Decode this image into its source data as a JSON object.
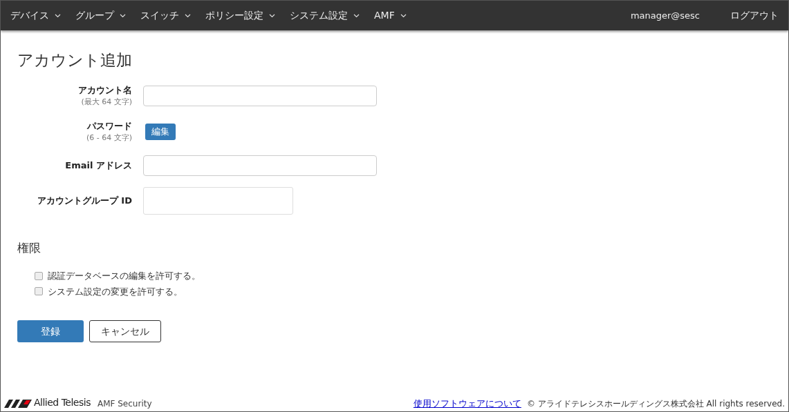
{
  "nav": {
    "menus": [
      {
        "label": "デバイス"
      },
      {
        "label": "グループ"
      },
      {
        "label": "スイッチ"
      },
      {
        "label": "ポリシー設定"
      },
      {
        "label": "システム設定"
      },
      {
        "label": "AMF"
      }
    ],
    "user": "manager@sesc",
    "logout": "ログアウト"
  },
  "page_title": "アカウント追加",
  "fields": [
    {
      "kind": "input",
      "label": "アカウント名",
      "hint": "(最大 64 文字)"
    },
    {
      "kind": "button",
      "label": "パスワード",
      "hint": "(6 - 64 文字)",
      "button": "編集"
    },
    {
      "kind": "input",
      "label": "Email アドレス"
    },
    {
      "kind": "short_input",
      "label": "アカウントグループ ID"
    }
  ],
  "permissions": {
    "title": "権限",
    "options": [
      {
        "label": "認証データベースの編集を許可する。",
        "checked": false
      },
      {
        "label": "システム設定の変更を許可する。",
        "checked": false
      }
    ]
  },
  "actions": {
    "submit": "登録",
    "cancel": "キャンセル"
  },
  "footer": {
    "brand": "Allied Telesis",
    "product": "AMF Security",
    "link": "使用ソフトウェアについて",
    "copyright": "© アライドテレシスホールディングス株式会社 All rights reserved."
  }
}
